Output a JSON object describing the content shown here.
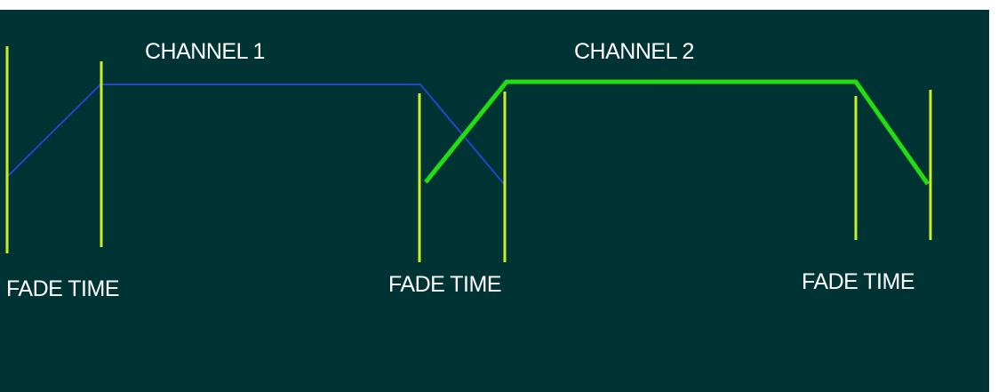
{
  "colors": {
    "background": "#003333",
    "channel_1_line": "#2a43c8",
    "channel_2_line": "#22dd11",
    "fade_marker": "#ccee22",
    "text": "#ffffff",
    "outer_frame": "#ffffff"
  },
  "channels": [
    {
      "label": "CHANNEL 1",
      "color_key": "channel_1_line"
    },
    {
      "label": "CHANNEL 2",
      "color_key": "channel_2_line"
    }
  ],
  "fade_labels": [
    {
      "label": "FADE TIME"
    },
    {
      "label": "FADE TIME"
    },
    {
      "label": "FADE TIME"
    }
  ]
}
